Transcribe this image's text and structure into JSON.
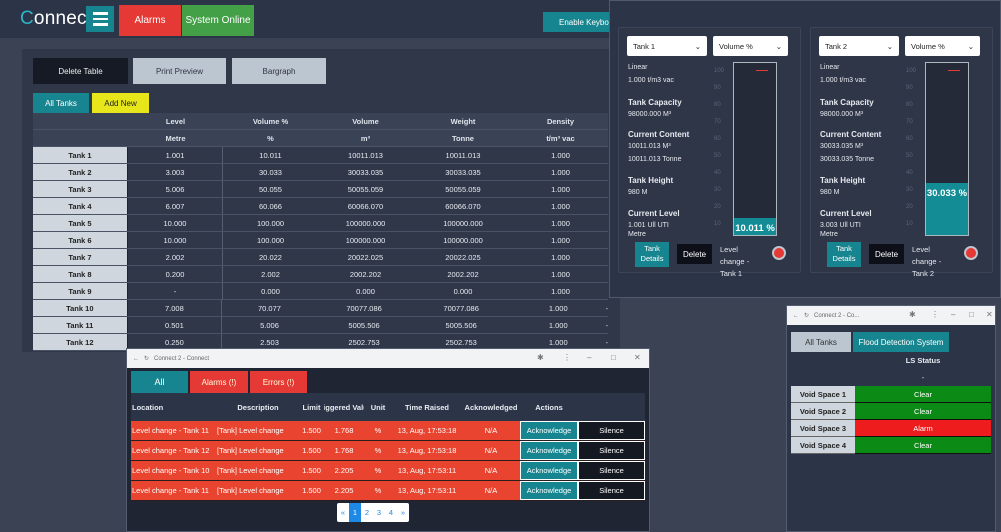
{
  "app": {
    "brand_first": "C",
    "brand_rest": "onnect",
    "alarms_button": "Alarms",
    "status_button": "System Online",
    "keyboard_button": "Enable Keyboard"
  },
  "toolbar": {
    "delete_table": "Delete Table",
    "print_preview": "Print Preview",
    "bargraph": "Bargraph"
  },
  "tabs": {
    "all_tanks": "All Tanks",
    "add_new": "Add New"
  },
  "main_table": {
    "headers": [
      "",
      "Level",
      "Volume %",
      "Volume",
      "Weight",
      "Density",
      "",
      ""
    ],
    "units": [
      "",
      "Metre",
      "%",
      "m³",
      "Tonne",
      "t/m³ vac",
      "",
      ""
    ],
    "rows": [
      [
        "Tank 1",
        "1.001",
        "10.011",
        "10011.013",
        "10011.013",
        "1.000",
        "",
        ""
      ],
      [
        "Tank 2",
        "3.003",
        "30.033",
        "30033.035",
        "30033.035",
        "1.000",
        "",
        ""
      ],
      [
        "Tank 3",
        "5.006",
        "50.055",
        "50055.059",
        "50055.059",
        "1.000",
        "",
        ""
      ],
      [
        "Tank 4",
        "6.007",
        "60.066",
        "60066.070",
        "60066.070",
        "1.000",
        "",
        ""
      ],
      [
        "Tank 5",
        "10.000",
        "100.000",
        "100000.000",
        "100000.000",
        "1.000",
        "",
        ""
      ],
      [
        "Tank 6",
        "10.000",
        "100.000",
        "100000.000",
        "100000.000",
        "1.000",
        "",
        ""
      ],
      [
        "Tank 7",
        "2.002",
        "20.022",
        "20022.025",
        "20022.025",
        "1.000",
        "",
        ""
      ],
      [
        "Tank 8",
        "0.200",
        "2.002",
        "2002.202",
        "2002.202",
        "1.000",
        "",
        ""
      ],
      [
        "Tank 9",
        "-",
        "0.000",
        "0.000",
        "0.000",
        "1.000",
        "",
        ""
      ],
      [
        "Tank 10",
        "7.008",
        "70.077",
        "70077.086",
        "70077.086",
        "1.000",
        "-",
        "-"
      ],
      [
        "Tank 11",
        "0.501",
        "5.006",
        "5005.506",
        "5005.506",
        "1.000",
        "-",
        "-"
      ],
      [
        "Tank 12",
        "0.250",
        "2.503",
        "2502.753",
        "2502.753",
        "1.000",
        "-",
        "-"
      ]
    ]
  },
  "tank_cards": [
    {
      "tank": "Tank 1",
      "measure": "Volume %",
      "linear": "Linear",
      "density": "1.000 t/m3 vac",
      "cap_label": "Tank Capacity",
      "cap_value": "98000.000 M³",
      "content_label": "Current Content",
      "content_m3": "10011.013 M³",
      "content_t": "10011.013 Tonne",
      "height_label": "Tank Height",
      "height_value": "980 M",
      "level_label": "Current Level",
      "level_value": "1.001 Ull UTI",
      "level_unit": "Metre",
      "gauge_text": "10.011 %",
      "fill_percent": 10.011,
      "details": "Tank Details",
      "delete": "Delete",
      "status_lines": [
        "Level",
        "change -",
        "Tank 1"
      ]
    },
    {
      "tank": "Tank 2",
      "measure": "Volume %",
      "linear": "Linear",
      "density": "1.000 t/m3 vac",
      "cap_label": "Tank Capacity",
      "cap_value": "98000.000 M³",
      "content_label": "Current Content",
      "content_m3": "30033.035 M³",
      "content_t": "30033.035 Tonne",
      "height_label": "Tank Height",
      "height_value": "980 M",
      "level_label": "Current Level",
      "level_value": "3.003 Ull UTI",
      "level_unit": "Metre",
      "gauge_text": "30.033 %",
      "fill_percent": 30.033,
      "details": "Tank Details",
      "delete": "Delete",
      "status_lines": [
        "Level",
        "change -",
        "Tank 2"
      ]
    }
  ],
  "alarm_window": {
    "title": "Connect 2 - Connect",
    "tabs": {
      "all": "All",
      "alarms": "Alarms (!)",
      "errors": "Errors (!)"
    },
    "headers": [
      "Location",
      "Description",
      "Limit",
      "Triggered Value",
      "Unit",
      "Time Raised",
      "Acknowledged",
      "Actions",
      ""
    ],
    "rows": [
      [
        "Level change - Tank 11",
        "[Tank] Level change",
        "1.500",
        "1.768",
        "%",
        "13, Aug, 17:53:18",
        "N/A",
        "Acknowledge",
        "Silence"
      ],
      [
        "Level change - Tank 12",
        "[Tank] Level change",
        "1.500",
        "1.768",
        "%",
        "13, Aug, 17:53:18",
        "N/A",
        "Acknowledge",
        "Silence"
      ],
      [
        "Level change - Tank 10",
        "[Tank] Level change",
        "1.500",
        "2.205",
        "%",
        "13, Aug, 17:53:11",
        "N/A",
        "Acknowledge",
        "Silence"
      ],
      [
        "Level change - Tank 11",
        "[Tank] Level change",
        "1.500",
        "2.205",
        "%",
        "13, Aug, 17:53:11",
        "N/A",
        "Acknowledge",
        "Silence"
      ]
    ],
    "pager": [
      "«",
      "1",
      "2",
      "3",
      "4",
      "»"
    ],
    "active_page": "1"
  },
  "flood_window": {
    "title": "Connect 2 - Co...",
    "tabs": {
      "all": "All Tanks",
      "flood": "Flood Detection System"
    },
    "header": "LS Status",
    "subheader": "-",
    "rows": [
      {
        "name": "Void Space 1",
        "status": "Clear"
      },
      {
        "name": "Void Space 2",
        "status": "Clear"
      },
      {
        "name": "Void Space 3",
        "status": "Alarm"
      },
      {
        "name": "Void Space 4",
        "status": "Clear"
      }
    ]
  }
}
